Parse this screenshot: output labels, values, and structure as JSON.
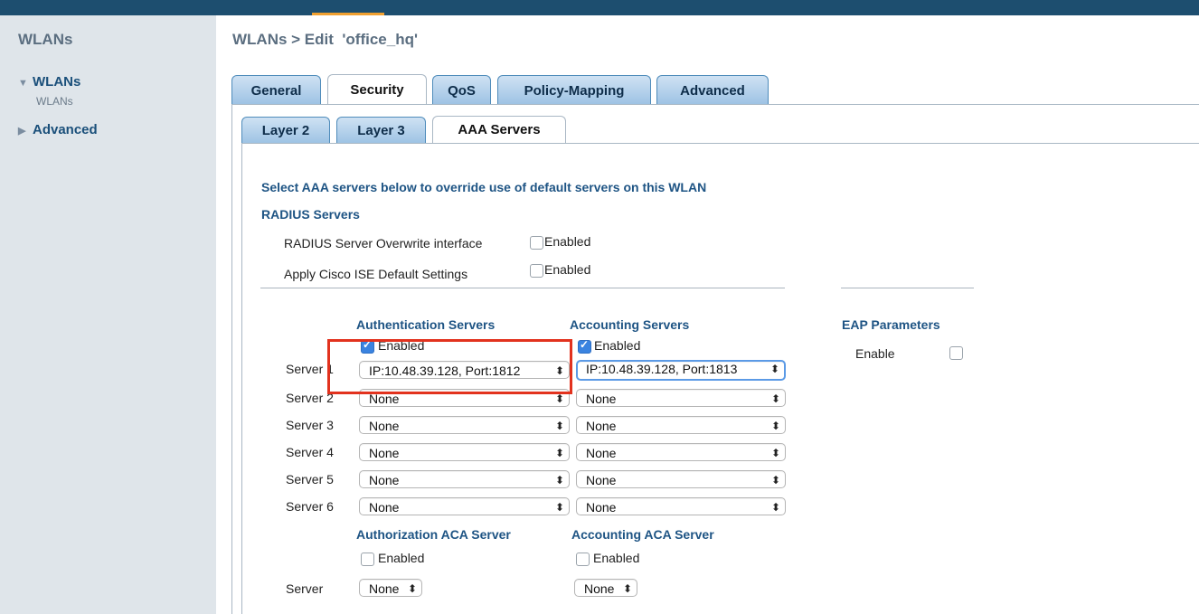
{
  "sidebar": {
    "title": "WLANs",
    "items": [
      {
        "label": "WLANs",
        "expanded": true,
        "children": [
          "WLANs"
        ]
      },
      {
        "label": "Advanced",
        "expanded": false
      }
    ]
  },
  "header": {
    "title": "WLANs > Edit  'office_hq'"
  },
  "tabs": [
    "General",
    "Security",
    "QoS",
    "Policy-Mapping",
    "Advanced"
  ],
  "active_tab": "Security",
  "subtabs": [
    "Layer 2",
    "Layer 3",
    "AAA Servers"
  ],
  "active_subtab": "AAA Servers",
  "aaa": {
    "intro": "Select AAA servers below to override use of default servers on this WLAN",
    "radius_heading": "RADIUS Servers",
    "overwrite_label": "RADIUS Server Overwrite interface",
    "overwrite_enabled": "Enabled",
    "ise_label": "Apply Cisco ISE Default Settings",
    "ise_enabled": "Enabled",
    "auth_header": "Authentication Servers",
    "acct_header": "Accounting Servers",
    "eap_header": "EAP Parameters",
    "auth_enabled": "Enabled",
    "acct_enabled": "Enabled",
    "eap_enable": "Enable",
    "servers": [
      {
        "label": "Server 1",
        "auth": "IP:10.48.39.128, Port:1812",
        "acct": "IP:10.48.39.128, Port:1813"
      },
      {
        "label": "Server 2",
        "auth": "None",
        "acct": "None"
      },
      {
        "label": "Server 3",
        "auth": "None",
        "acct": "None"
      },
      {
        "label": "Server 4",
        "auth": "None",
        "acct": "None"
      },
      {
        "label": "Server 5",
        "auth": "None",
        "acct": "None"
      },
      {
        "label": "Server 6",
        "auth": "None",
        "acct": "None"
      }
    ],
    "authz_aca_header": "Authorization ACA Server",
    "acct_aca_header": "Accounting ACA Server",
    "authz_aca_enabled": "Enabled",
    "acct_aca_enabled": "Enabled",
    "aca_server_label": "Server",
    "authz_aca_value": "None",
    "acct_aca_value": "None"
  },
  "colors": {
    "topbar": "#1d4e6f",
    "sidebar": "#dfe5ea",
    "heading_blue": "#1e5484",
    "highlight_red": "#e2321e"
  }
}
